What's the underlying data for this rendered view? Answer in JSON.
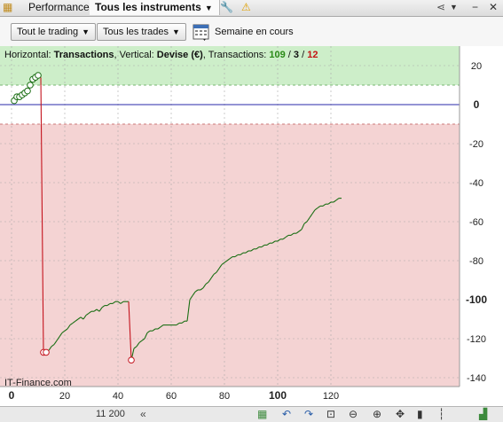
{
  "tabs": {
    "performance": "Performance",
    "instruments": "Tous les instruments"
  },
  "toolbar": {
    "trading_mode": "Tout le trading",
    "trades_filter": "Tous les trades",
    "period": "Semaine en cours"
  },
  "chart_header": {
    "horizontal_prefix": "Horizontal: ",
    "horizontal_value": "Transactions",
    "vertical_prefix": ", Vertical: ",
    "vertical_value": "Devise (€)",
    "transactions_prefix": ", Transactions: ",
    "count_winning": "109",
    "sep1": " / ",
    "count_neutral": "3",
    "sep2": " / ",
    "count_losing": "12"
  },
  "watermark": "IT-Finance.com",
  "status_value": "11 200",
  "colors": {
    "profit_zone": "#cdeec9",
    "loss_zone": "#f4d3d3",
    "zero_line": "#2a2aa8",
    "equity_up": "#1b6e14",
    "equity_down": "#c4141e",
    "winning_count": "#2a8a17",
    "losing_count": "#c41414"
  },
  "chart_data": {
    "type": "line",
    "xlabel": "",
    "ylabel": "",
    "xlim": [
      0,
      131
    ],
    "ylim": [
      -141,
      24
    ],
    "x_ticks": [
      0,
      20,
      40,
      60,
      80,
      100,
      120
    ],
    "y_ticks": [
      20,
      0,
      -20,
      -40,
      -60,
      -80,
      -100,
      -120,
      -140
    ],
    "grid": true,
    "profit_threshold": 10,
    "loss_threshold": -10,
    "series": [
      {
        "x": [
          1,
          2,
          3,
          4,
          5,
          6,
          7,
          8,
          9,
          10,
          11,
          12,
          13,
          14,
          15,
          16,
          17,
          18,
          19,
          20,
          21,
          22,
          23,
          24,
          25,
          26,
          27,
          28,
          29,
          30,
          31,
          32,
          33,
          34,
          35,
          36,
          37,
          38,
          39,
          40,
          41,
          42,
          43,
          44,
          45,
          46,
          47,
          48,
          49,
          50,
          51,
          52,
          53,
          54,
          55,
          56,
          57,
          58,
          59,
          60,
          61,
          62,
          63,
          64,
          65,
          66,
          67,
          68,
          69,
          70,
          71,
          72,
          73,
          74,
          75,
          76,
          77,
          78,
          79,
          80,
          81,
          82,
          83,
          84,
          85,
          86,
          87,
          88,
          89,
          90,
          91,
          92,
          93,
          94,
          95,
          96,
          97,
          98,
          99,
          100,
          101,
          102,
          103,
          104,
          105,
          106,
          107,
          108,
          109,
          110,
          111,
          112,
          113,
          114,
          115,
          116,
          117,
          118,
          119,
          120,
          121,
          122,
          123,
          124
        ],
        "y": [
          2,
          4,
          4,
          5,
          6,
          7,
          10,
          13,
          14,
          15,
          14,
          -127,
          -127,
          -126,
          -124,
          -123,
          -121,
          -119,
          -117,
          -116,
          -115,
          -113,
          -112,
          -111,
          -110,
          -109,
          -110,
          -108,
          -107,
          -106,
          -106,
          -105,
          -106,
          -104,
          -103,
          -103,
          -102,
          -102,
          -101,
          -101,
          -102,
          -101,
          -101,
          -101,
          -131,
          -125,
          -124,
          -122,
          -121,
          -120,
          -117,
          -116,
          -116,
          -115,
          -115,
          -114,
          -113,
          -113,
          -113,
          -113,
          -113,
          -113,
          -112,
          -112,
          -111,
          -111,
          -100,
          -98,
          -96,
          -95,
          -95,
          -94,
          -92,
          -91,
          -89,
          -87,
          -86,
          -84,
          -82,
          -81,
          -80,
          -79,
          -78,
          -78,
          -77,
          -77,
          -76,
          -76,
          -75,
          -75,
          -74,
          -74,
          -73,
          -73,
          -72,
          -72,
          -71,
          -71,
          -70,
          -70,
          -69,
          -69,
          -68,
          -67,
          -67,
          -66,
          -66,
          -65,
          -64,
          -61,
          -60,
          -58,
          -56,
          -54,
          -53,
          -52,
          -52,
          -51,
          -51,
          -50,
          -50,
          -49,
          -48,
          -48
        ]
      }
    ],
    "markers": [
      {
        "x": 1,
        "y": 2
      },
      {
        "x": 2,
        "y": 4
      },
      {
        "x": 3,
        "y": 4
      },
      {
        "x": 4,
        "y": 5
      },
      {
        "x": 5,
        "y": 6
      },
      {
        "x": 6,
        "y": 7
      },
      {
        "x": 7,
        "y": 10
      },
      {
        "x": 8,
        "y": 13
      },
      {
        "x": 9,
        "y": 14
      },
      {
        "x": 10,
        "y": 15
      },
      {
        "x": 12,
        "y": -127
      },
      {
        "x": 13,
        "y": -127
      },
      {
        "x": 45,
        "y": -131
      }
    ]
  }
}
